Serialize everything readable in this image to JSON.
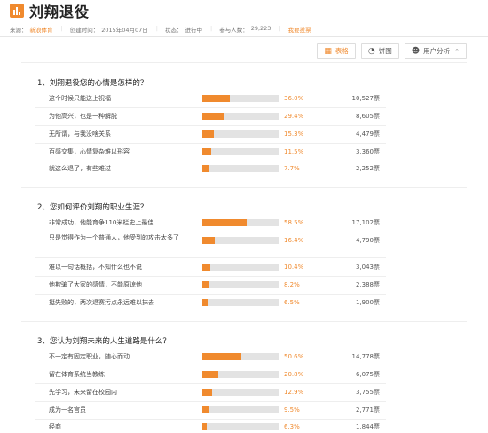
{
  "header": {
    "title": "刘翔退役",
    "icon": "bar-chart-icon",
    "accent": "#f08a2e"
  },
  "meta": {
    "source_label": "来源：",
    "source_value": "新浪体育",
    "created_label": "创建时间：",
    "created_value": "2015年04月07日",
    "status_label": "状态：",
    "status_value": "进行中",
    "participants_label": "参与人数：",
    "participants_value": "29,223",
    "vote_link": "我要投票"
  },
  "tabs": [
    {
      "label": "表格",
      "icon": "grid-icon",
      "glyph": "▦"
    },
    {
      "label": "饼图",
      "icon": "pie-chart-icon",
      "glyph": "◔"
    },
    {
      "label": "用户分析",
      "icon": "user-icon",
      "glyph": "👤",
      "caret": "⌃"
    }
  ],
  "questions": [
    {
      "title": "1、刘翔退役您的心情是怎样的？",
      "options": [
        {
          "label": "这个时候只能送上祝福",
          "pct": "36.0%",
          "value": 36.0,
          "votes": "10,527票"
        },
        {
          "label": "为他高兴，也是一种解脱",
          "pct": "29.4%",
          "value": 29.4,
          "votes": "8,605票"
        },
        {
          "label": "无所谓，与我没啥关系",
          "pct": "15.3%",
          "value": 15.3,
          "votes": "4,479票"
        },
        {
          "label": "百感交集，心情复杂难以形容",
          "pct": "11.5%",
          "value": 11.5,
          "votes": "3,360票"
        },
        {
          "label": "就这么退了，有些难过",
          "pct": "7.7%",
          "value": 7.7,
          "votes": "2,252票"
        }
      ]
    },
    {
      "title": "2、您如何评价刘翔的职业生涯？",
      "options": [
        {
          "label": "非常成功，他能育争110米栏史上最佳",
          "pct": "58.5%",
          "value": 58.5,
          "votes": "17,102票"
        },
        {
          "label": "只是觉得作为一个普通人，他受到的攻击太多了",
          "pct": "16.4%",
          "value": 16.4,
          "votes": "4,790票"
        },
        {
          "label": "难以一句话概括，不知什么也不说",
          "pct": "10.4%",
          "value": 10.4,
          "votes": "3,043票"
        },
        {
          "label": "他欺骗了大家的感情，不能原谅他",
          "pct": "8.2%",
          "value": 8.2,
          "votes": "2,388票"
        },
        {
          "label": "挺失败的，两次退赛污点永远难以抹去",
          "pct": "6.5%",
          "value": 6.5,
          "votes": "1,900票"
        }
      ]
    },
    {
      "title": "3、您认为刘翔未来的人生道路是什么？",
      "options": [
        {
          "label": "不一定有固定职业，随心而动",
          "pct": "50.6%",
          "value": 50.6,
          "votes": "14,778票"
        },
        {
          "label": "留在体育系统当教练",
          "pct": "20.8%",
          "value": 20.8,
          "votes": "6,075票"
        },
        {
          "label": "先学习，未来留在校园内",
          "pct": "12.9%",
          "value": 12.9,
          "votes": "3,755票"
        },
        {
          "label": "成为一名官员",
          "pct": "9.5%",
          "value": 9.5,
          "votes": "2,771票"
        },
        {
          "label": "经商",
          "pct": "6.3%",
          "value": 6.3,
          "votes": "1,844票"
        }
      ]
    }
  ]
}
